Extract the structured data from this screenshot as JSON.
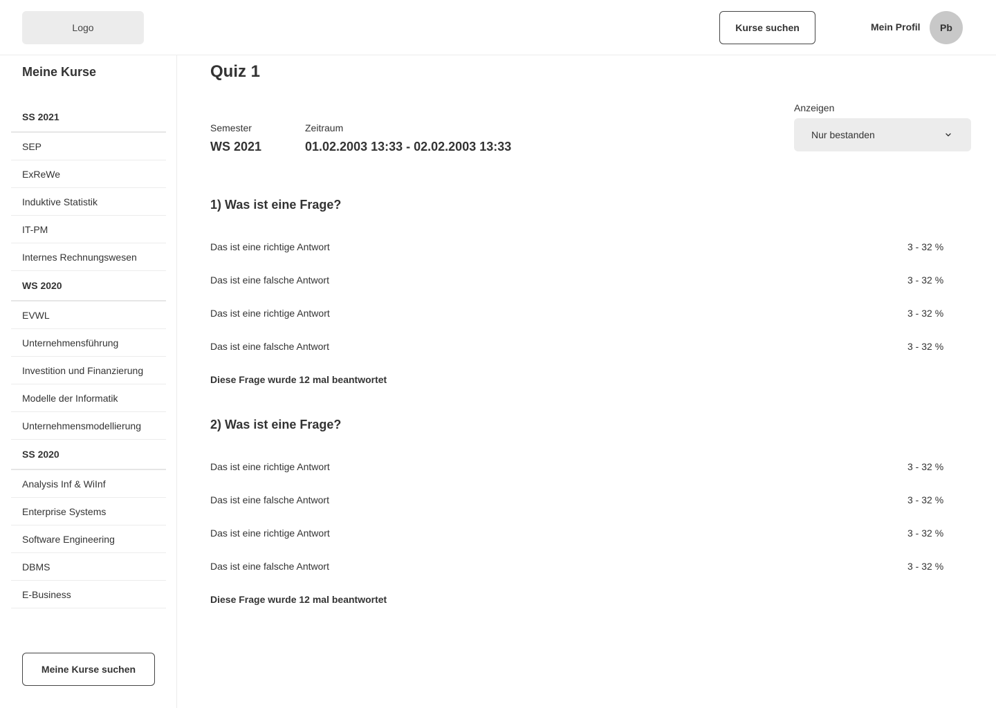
{
  "header": {
    "logo": "Logo",
    "search_courses": "Kurse suchen",
    "profile_label": "Mein Profil",
    "avatar_initials": "Pb"
  },
  "sidebar": {
    "title": "Meine Kurse",
    "groups": [
      {
        "heading": "SS 2021",
        "items": [
          "SEP",
          "ExReWe",
          "Induktive Statistik",
          "IT-PM",
          "Internes Rechnungswesen"
        ]
      },
      {
        "heading": "WS 2020",
        "items": [
          "EVWL",
          "Unternehmensführung",
          "Investition und Finanzierung",
          "Modelle der Informatik",
          "Unternehmensmodellierung"
        ]
      },
      {
        "heading": "SS 2020",
        "items": [
          "Analysis Inf & WiInf",
          "Enterprise Systems",
          "Software Engineering",
          "DBMS",
          "E-Business"
        ]
      }
    ],
    "search_button": "Meine Kurse suchen"
  },
  "main": {
    "title": "Quiz 1",
    "semester_label": "Semester",
    "semester_value": "WS 2021",
    "period_label": "Zeitraum",
    "period_value": "01.02.2003 13:33 -  02.02.2003 13:33",
    "filter_label": "Anzeigen",
    "filter_selected": "Nur bestanden",
    "questions": [
      {
        "title": "1) Was ist eine Frage?",
        "answers": [
          {
            "text": "Das ist eine richtige Antwort",
            "result": "3 - 32 %"
          },
          {
            "text": "Das ist eine falsche Antwort",
            "result": "3 - 32 %"
          },
          {
            "text": "Das ist eine richtige Antwort",
            "result": "3 - 32 %"
          },
          {
            "text": "Das ist eine falsche Antwort",
            "result": "3 - 32 %"
          }
        ],
        "footer": "Diese Frage wurde 12 mal beantwortet"
      },
      {
        "title": "2) Was ist eine Frage?",
        "answers": [
          {
            "text": "Das ist eine richtige Antwort",
            "result": "3 - 32 %"
          },
          {
            "text": "Das ist eine falsche Antwort",
            "result": "3 - 32 %"
          },
          {
            "text": "Das ist eine richtige Antwort",
            "result": "3 - 32 %"
          },
          {
            "text": "Das ist eine falsche Antwort",
            "result": "3 - 32 %"
          }
        ],
        "footer": "Diese Frage wurde 12 mal beantwortet"
      }
    ]
  }
}
